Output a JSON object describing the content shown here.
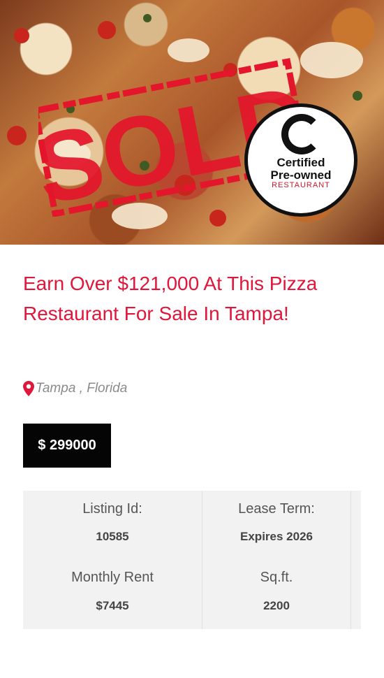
{
  "hero": {
    "stamp_text": "SOLD",
    "badge": {
      "line1": "Certified",
      "line2": "Pre-owned",
      "line3": "RESTAURANT"
    }
  },
  "listing": {
    "title": "Earn Over $121,000 At This Pizza Restaurant For Sale In Tampa!",
    "location": "Tampa , Florida",
    "price": "$ 299000",
    "details": [
      {
        "label": "Listing Id:",
        "value": "10585"
      },
      {
        "label": "Lease Term:",
        "value": "Expires 2026"
      },
      {
        "label": "Monthly Rent",
        "value": "$7445"
      },
      {
        "label": "Sq.ft.",
        "value": "2200"
      }
    ]
  },
  "colors": {
    "accent": "#e0163a",
    "price_bg": "#050505",
    "stamp_red": "#e3162b",
    "grid_bg": "#f2f2f2"
  },
  "icons": {
    "location": "map-pin-icon",
    "badge_mark": "certified-c-icon"
  }
}
